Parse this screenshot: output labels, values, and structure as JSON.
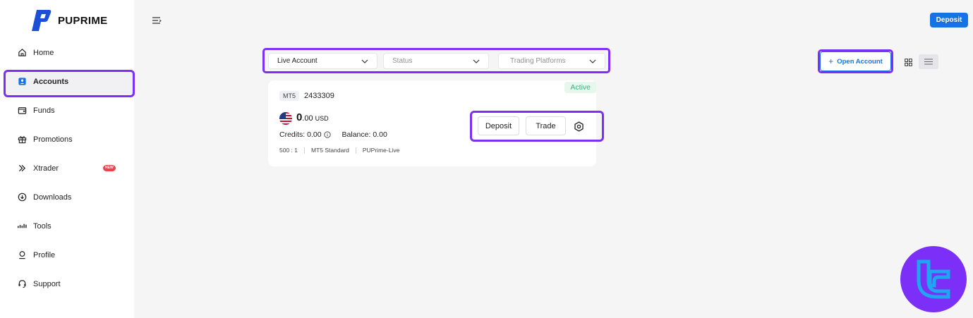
{
  "brand": {
    "name": "PUPRIME",
    "color": "#1a4fd6"
  },
  "colors": {
    "accent": "#1673e6",
    "highlight": "#7b2ff7",
    "active_status": "#36b37e",
    "new_badge": "#e8464b"
  },
  "sidebar": {
    "items": [
      {
        "label": "Home",
        "icon": "home-icon"
      },
      {
        "label": "Accounts",
        "icon": "accounts-icon",
        "active": true
      },
      {
        "label": "Funds",
        "icon": "wallet-icon"
      },
      {
        "label": "Promotions",
        "icon": "gift-icon"
      },
      {
        "label": "Xtrader",
        "icon": "double-chevron-icon",
        "badge": "NEW"
      },
      {
        "label": "Downloads",
        "icon": "download-icon"
      },
      {
        "label": "Tools",
        "icon": "tools-icon"
      },
      {
        "label": "Profile",
        "icon": "profile-icon"
      },
      {
        "label": "Support",
        "icon": "headset-icon"
      }
    ]
  },
  "header": {
    "deposit_label": "Deposit"
  },
  "filters": {
    "account_type": "Live Account",
    "status_placeholder": "Status",
    "platform_placeholder": "Trading Platforms"
  },
  "toolbar": {
    "open_account_label": "Open Account",
    "view_mode": "list"
  },
  "account_card": {
    "platform_tag": "MT5",
    "account_number": "2433309",
    "status": "Active",
    "balance_int": "0",
    "balance_dec": ".00",
    "currency": "USD",
    "credits_label": "Credits:",
    "credits_value": "0.00",
    "balance_label": "Balance:",
    "balance_value": "0.00",
    "leverage": "500 : 1",
    "account_type": "MT5 Standard",
    "server": "PUPrime-Live",
    "deposit_label": "Deposit",
    "trade_label": "Trade"
  }
}
